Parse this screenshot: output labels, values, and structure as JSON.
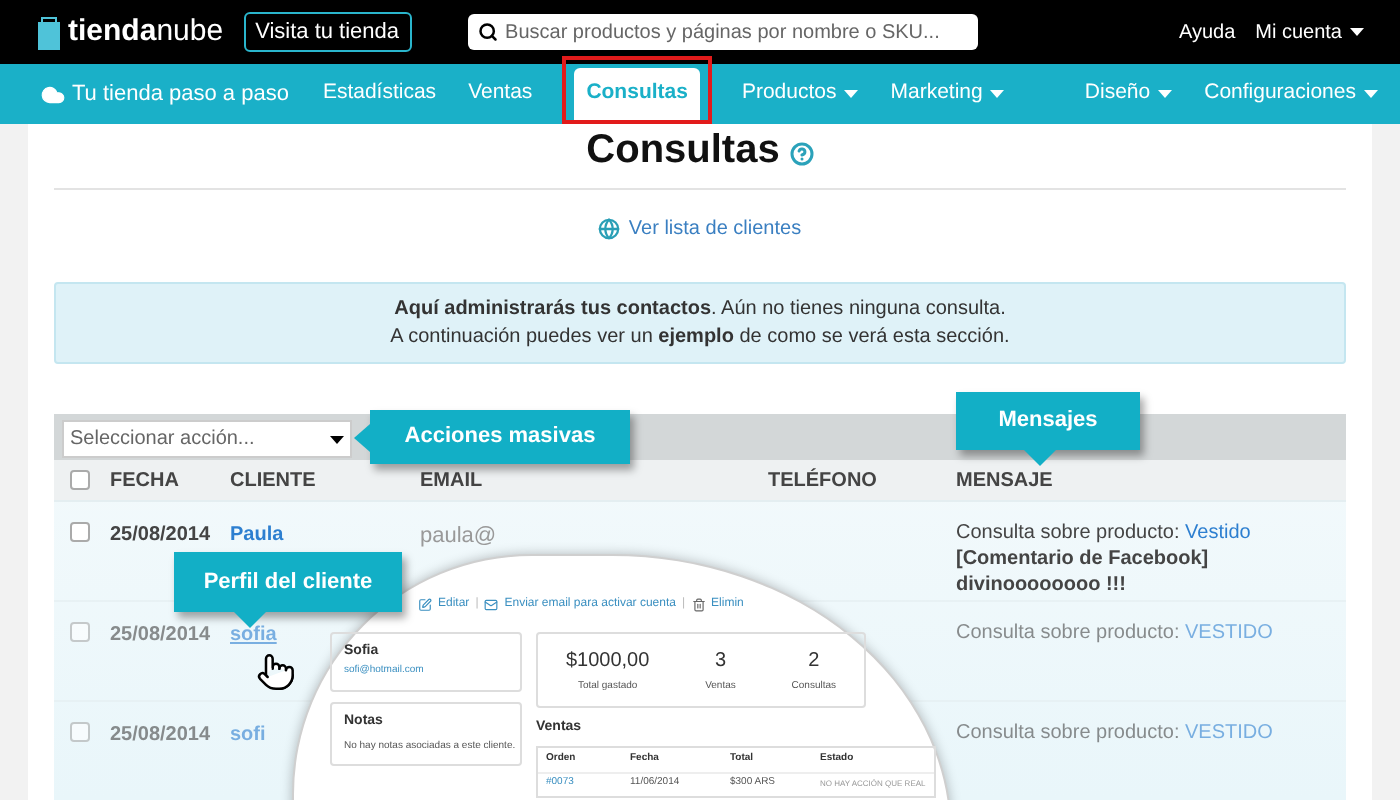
{
  "topbar": {
    "logo": "**tienda**nube",
    "visit_button": "Visita tu tienda",
    "search": {
      "placeholder": "Buscar productos y páginas por nombre o SKU..."
    },
    "links": [
      {
        "label": "Ayuda",
        "dropdown": false
      },
      {
        "label": "Mi cuenta",
        "dropdown": true
      }
    ]
  },
  "nav": {
    "home": "Tu tienda paso a paso",
    "left": [
      {
        "label": "Estadísticas",
        "dropdown": false,
        "selected": false
      },
      {
        "label": "Ventas",
        "dropdown": false,
        "selected": false
      },
      {
        "label": "Consultas",
        "dropdown": false,
        "selected": true
      },
      {
        "label": "Productos",
        "dropdown": true,
        "selected": false
      },
      {
        "label": "Marketing",
        "dropdown": true,
        "selected": false
      }
    ],
    "right": [
      {
        "label": "Diseño",
        "dropdown": true,
        "selected": false
      },
      {
        "label": "Configuraciones",
        "dropdown": true,
        "selected": false
      }
    ]
  },
  "page": {
    "title": "Consultas",
    "link": "Ver lista de clientes",
    "info": [
      "**Aquí administrarás tus contactos**. Aún no tienes ninguna consulta.",
      "A continuación puedes ver un **ejemplo** de como se verá esta sección."
    ]
  },
  "example": {
    "bulk_select": {
      "placeholder": "Seleccionar acción..."
    },
    "columns": [
      "FECHA",
      "CLIENTE",
      "EMAIL",
      "TELÉFONO",
      "MENSAJE"
    ],
    "rows": [
      {
        "date": "25/08/2014",
        "client": "Paula",
        "email": "paula@",
        "prefix": "Consulta sobre producto:",
        "product": "Vestido",
        "comment": "[Comentario de Facebook] divinoooooooo !!!",
        "faded": false,
        "checked": false
      },
      {
        "date": "25/08/2014",
        "client": "sofia",
        "email": "",
        "prefix": "Consulta sobre producto:",
        "product": "VESTIDO",
        "comment": "",
        "faded": true,
        "checked": false
      },
      {
        "date": "25/08/2014",
        "client": "sofi",
        "email": "",
        "prefix": "Consulta sobre producto:",
        "product": "VESTIDO",
        "comment": "",
        "faded": true,
        "checked": false
      }
    ],
    "select_all_checked": false,
    "callouts": [
      {
        "text": "Acciones masivas"
      },
      {
        "text": "Mensajes"
      },
      {
        "text": "Perfil del cliente"
      }
    ],
    "profile": {
      "actions": [
        "Editar",
        "Enviar email para activar cuenta",
        "Elimin"
      ],
      "separator": "|",
      "customer": {
        "name": "Sofia",
        "email": "sofi@hotmail.com"
      },
      "stats": [
        {
          "value": "$1000,00",
          "label": "Total gastado"
        },
        {
          "value": "3",
          "label": "Ventas"
        },
        {
          "value": "2",
          "label": "Consultas"
        }
      ],
      "notes": {
        "title": "Notas",
        "text": "No hay notas asociadas a este cliente."
      },
      "sales": {
        "title": "Ventas",
        "columns": [
          "Orden",
          "Fecha",
          "Total",
          "Estado"
        ],
        "rows": [
          [
            "#0073",
            "11/06/2014",
            "$300 ARS",
            "NO HAY ACCIÓN QUE REAL"
          ]
        ]
      }
    }
  }
}
